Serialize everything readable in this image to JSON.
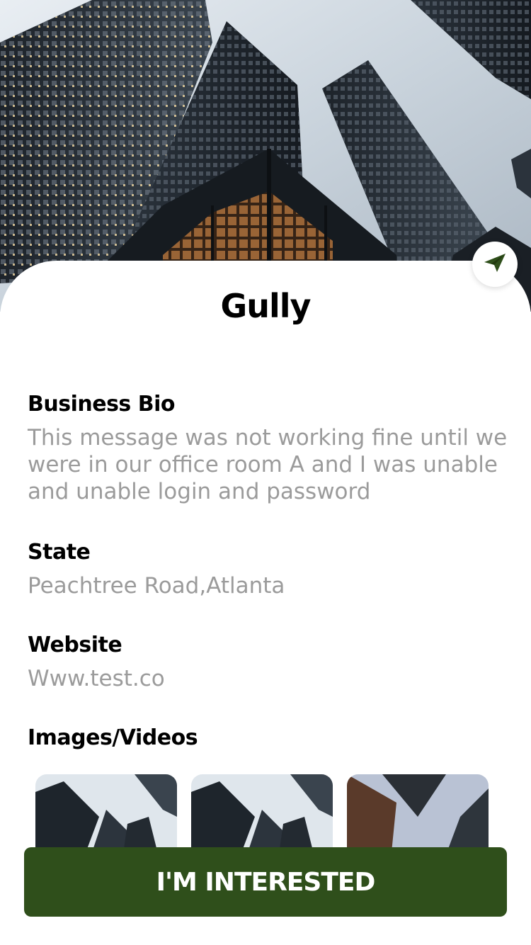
{
  "business": {
    "name": "Gully"
  },
  "hero": {
    "image": "skyscrapers-photo"
  },
  "share": {
    "icon": "send-icon",
    "color": "#2f4f1b"
  },
  "details": {
    "bio_label": "Business Bio",
    "bio_value": "This message was not working fine until we were in our office room A and I was unable and unable login and password",
    "state_label": "State",
    "state_value": "Peachtree Road,Atlanta",
    "website_label": "Website",
    "website_value": "Www.test.co"
  },
  "media": {
    "label": "Images/Videos",
    "thumbnails": [
      "building-thumbnail",
      "building-thumbnail",
      "building-thumbnail"
    ]
  },
  "cta": {
    "label": "I'M INTERESTED",
    "color": "#2f4f1b"
  }
}
